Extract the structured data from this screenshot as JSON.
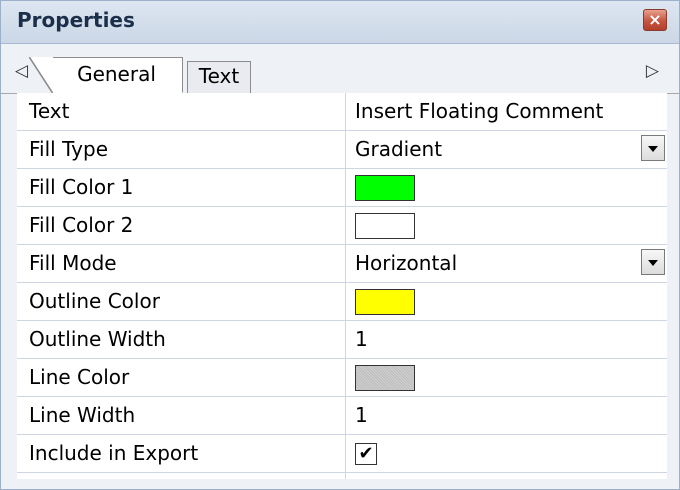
{
  "window": {
    "title": "Properties",
    "close_glyph": "×"
  },
  "tabs": [
    {
      "label": "General",
      "selected": true
    },
    {
      "label": "Text",
      "selected": false
    }
  ],
  "tabbar": {
    "left_arrow": "◁",
    "right_arrow": "▷"
  },
  "properties": [
    {
      "label": "Text",
      "value": "Insert Floating Comment",
      "type": "text"
    },
    {
      "label": "Fill Type",
      "value": "Gradient",
      "type": "dropdown"
    },
    {
      "label": "Fill Color 1",
      "type": "color",
      "color": "#00ff00"
    },
    {
      "label": "Fill Color 2",
      "type": "color",
      "color": "#ffffff"
    },
    {
      "label": "Fill Mode",
      "value": "Horizontal",
      "type": "dropdown"
    },
    {
      "label": "Outline Color",
      "type": "color",
      "color": "#ffff00"
    },
    {
      "label": "Outline Width",
      "value": "1",
      "type": "text"
    },
    {
      "label": "Line Color",
      "type": "color",
      "color": "#c0c0c0"
    },
    {
      "label": "Line Width",
      "value": "1",
      "type": "text"
    },
    {
      "label": "Include in Export",
      "type": "checkbox",
      "checked": true,
      "check_glyph": "✔"
    }
  ],
  "colors": {
    "titlebar": "#cbd7e6",
    "close_button": "#c6543f",
    "grid_line": "#cfd6e3"
  }
}
